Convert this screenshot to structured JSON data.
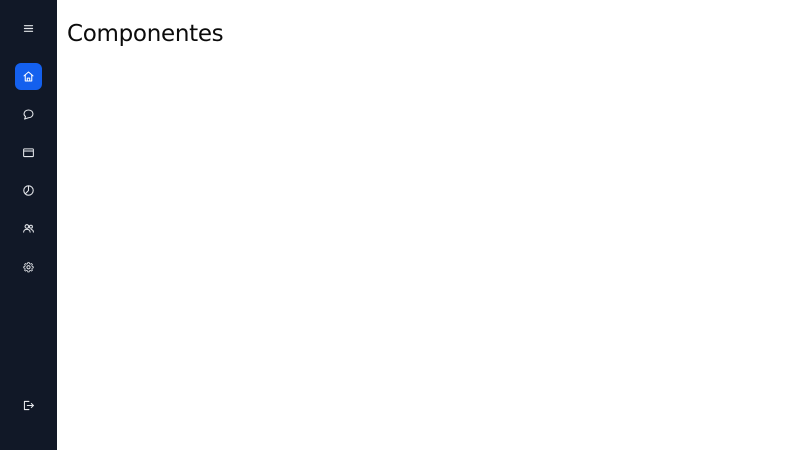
{
  "page": {
    "title": "Componentes"
  },
  "sidebar": {
    "background_color": "#111827",
    "accent_color": "#1460ee",
    "icon_color": "#e5e7eb",
    "menu_toggle": {
      "icon": "menu-icon"
    },
    "items": [
      {
        "id": "home",
        "icon": "home-icon",
        "active": true
      },
      {
        "id": "chat",
        "icon": "chat-bubble-icon",
        "active": false
      },
      {
        "id": "folder",
        "icon": "folder-icon",
        "active": false
      },
      {
        "id": "reports",
        "icon": "pie-chart-icon",
        "active": false
      },
      {
        "id": "users",
        "icon": "users-icon",
        "active": false
      },
      {
        "id": "settings",
        "icon": "gear-icon",
        "active": false
      }
    ],
    "logout": {
      "icon": "logout-icon"
    }
  }
}
